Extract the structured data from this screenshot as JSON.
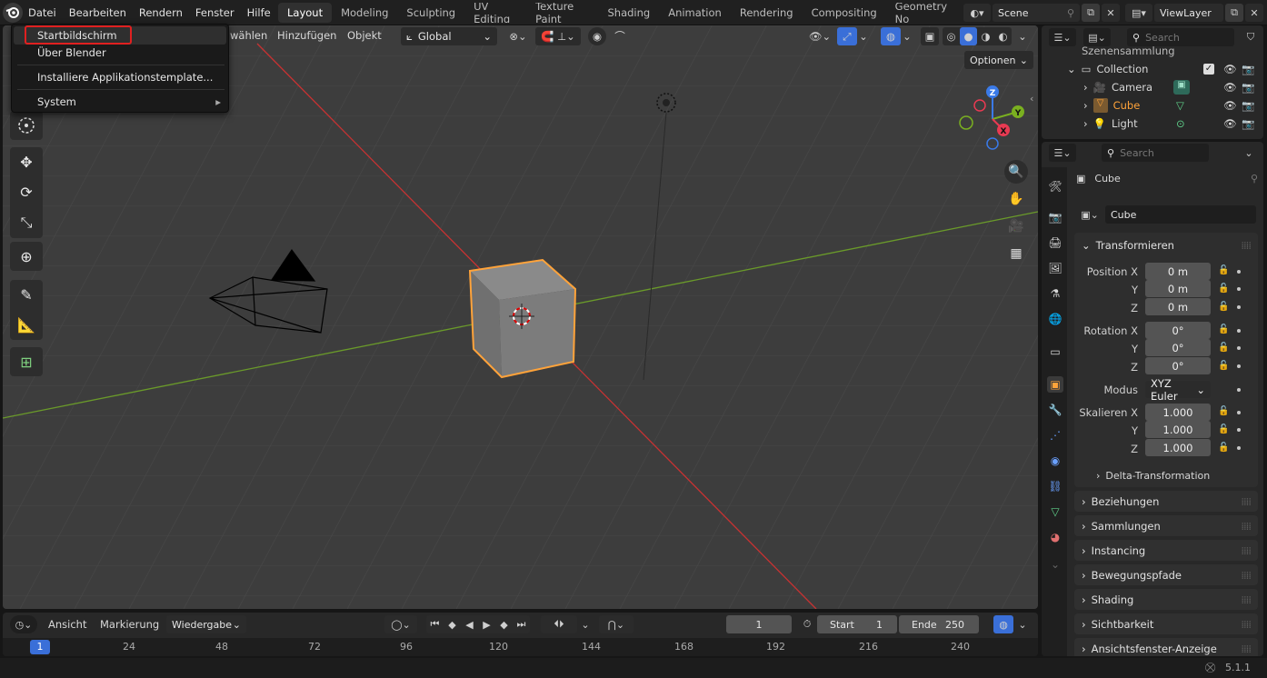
{
  "app": {
    "version": "5.1.1",
    "colors": {
      "accent_orange": "#ffa33a",
      "axis_red": "#c83232",
      "axis_green": "#6a9a2a",
      "highlight_box": "#e02020",
      "selected_blue": "#3a6fd8"
    }
  },
  "topbar": {
    "menus": [
      "Datei",
      "Bearbeiten",
      "Rendern",
      "Fenster",
      "Hilfe"
    ],
    "workspaces": [
      "Layout",
      "Modeling",
      "Sculpting",
      "UV Editing",
      "Texture Paint",
      "Shading",
      "Animation",
      "Rendering",
      "Compositing",
      "Geometry No"
    ],
    "scene_name": "Scene",
    "view_layer": "ViewLayer"
  },
  "file_menu": {
    "items": [
      "Startbildschirm",
      "Über Blender",
      "Installiere Applikationstemplate...",
      "System"
    ]
  },
  "viewport": {
    "header_items": [
      "wählen",
      "Hinzufügen",
      "Objekt"
    ],
    "orientation": "Global",
    "options_label": "Optionen",
    "gizmo_labels": {
      "x": "X",
      "y": "Y",
      "z": "Z"
    }
  },
  "outliner": {
    "search_placeholder": "Search",
    "root": "Szenensammlung",
    "collection": "Collection",
    "objects": [
      "Camera",
      "Cube",
      "Light"
    ],
    "active_object": "Cube"
  },
  "properties": {
    "search_placeholder": "Search",
    "object_name": "Cube",
    "data_name": "Cube",
    "transform_panel": "Transformieren",
    "position_label": "Position X",
    "rotation_label": "Rotation X",
    "scale_label": "Skalieren X",
    "axis_y": "Y",
    "axis_z": "Z",
    "position": [
      "0 m",
      "0 m",
      "0 m"
    ],
    "rotation": [
      "0°",
      "0°",
      "0°"
    ],
    "mode_label": "Modus",
    "mode_value": "XYZ Euler",
    "scale": [
      "1.000",
      "1.000",
      "1.000"
    ],
    "delta": "Delta-Transformation",
    "panels": [
      "Beziehungen",
      "Sammlungen",
      "Instancing",
      "Bewegungspfade",
      "Shading",
      "Sichtbarkeit",
      "Ansichtsfenster-Anzeige"
    ]
  },
  "timeline": {
    "menus": [
      "Ansicht",
      "Markierung"
    ],
    "playback": "Wiedergabe",
    "current_frame": "1",
    "start_label": "Start",
    "start": "1",
    "end_label": "Ende",
    "end": "250",
    "ruler": [
      "1",
      "24",
      "48",
      "72",
      "96",
      "120",
      "144",
      "168",
      "192",
      "216",
      "240"
    ]
  }
}
